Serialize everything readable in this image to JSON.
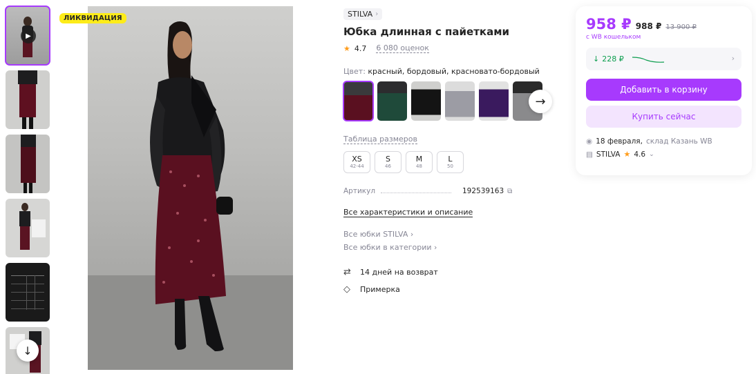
{
  "badge": "ЛИКВИДАЦИЯ",
  "product": {
    "brand": "STILVA",
    "title": "Юбка длинная с пайетками",
    "rating": "4.7",
    "reviews": "6 080 оценок",
    "color_label": "Цвет:",
    "color_value": "красный, бордовый, красновато-бордовый",
    "size_table_link": "Таблица размеров",
    "sizes": [
      {
        "name": "XS",
        "sub": "42-44"
      },
      {
        "name": "S",
        "sub": "46"
      },
      {
        "name": "M",
        "sub": "48"
      },
      {
        "name": "L",
        "sub": "50"
      }
    ],
    "article_label": "Артикул",
    "article_value": "192539163",
    "all_specs_link": "Все характеристики и описание",
    "brand_link": "Все юбки STILVA",
    "category_link": "Все юбки в категории",
    "returns": "14 дней на возврат",
    "fitting": "Примерка"
  },
  "card": {
    "price_main": "958 ₽",
    "price_alt": "988 ₽",
    "price_old": "13 900 ₽",
    "wallet_note": "с WB кошельком",
    "cashback": "228 ₽",
    "add_to_cart": "Добавить в корзину",
    "buy_now": "Купить сейчас",
    "delivery_date": "18 февраля,",
    "warehouse": "склад Казань WB",
    "seller_name": "STILVA",
    "seller_rating": "4.6"
  },
  "colors": {
    "accent": "#a73afd",
    "badge_bg": "#fdec19",
    "cashback_green": "#0d9e4f",
    "star": "#ff9c1a"
  }
}
